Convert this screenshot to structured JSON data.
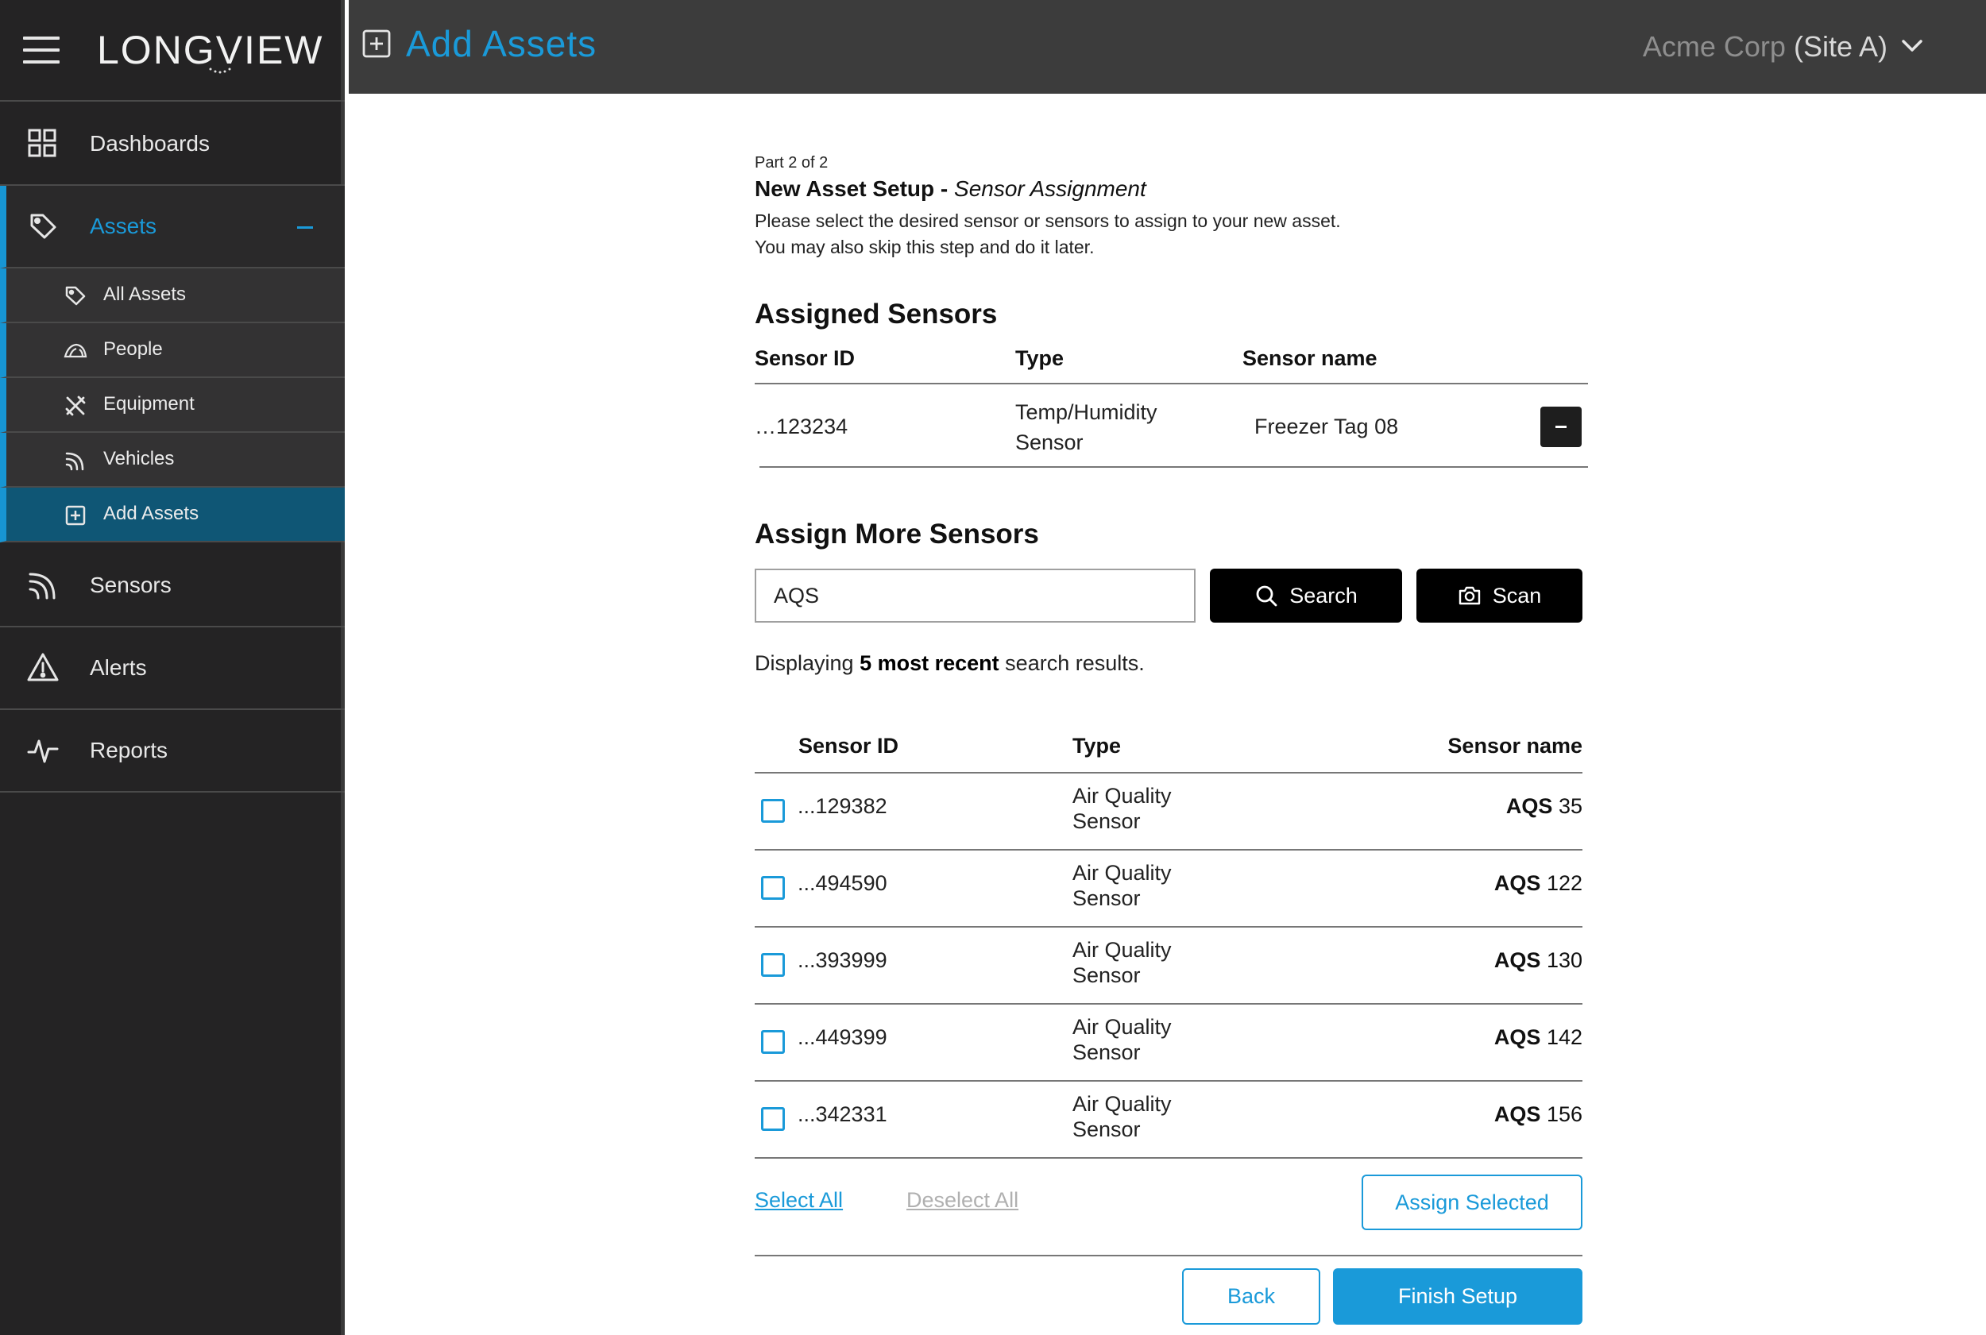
{
  "app": {
    "logo_text": "LONGVIEW",
    "page_title": "Add Assets",
    "org_name": "Acme Corp",
    "org_site": "(Site A)"
  },
  "sidebar": {
    "items": [
      {
        "label": "Dashboards",
        "icon": "dashboard-grid-icon"
      },
      {
        "label": "Assets",
        "icon": "tag-icon"
      },
      {
        "label": "Sensors",
        "icon": "sensor-signal-icon"
      },
      {
        "label": "Alerts",
        "icon": "alert-triangle-icon"
      },
      {
        "label": "Reports",
        "icon": "pulse-icon"
      }
    ],
    "sub_items": [
      {
        "label": "All Assets",
        "icon": "tag-icon"
      },
      {
        "label": "People",
        "icon": "people-icon"
      },
      {
        "label": "Equipment",
        "icon": "tools-icon"
      },
      {
        "label": "Vehicles",
        "icon": "signal-icon"
      },
      {
        "label": "Add Assets",
        "icon": "plus-square-icon"
      }
    ],
    "accent": "#1a9ad9"
  },
  "setup": {
    "part": "Part 2 of 2",
    "title": "New Asset Setup -",
    "subtitle": "Sensor Assignment",
    "desc_line1": "Please select the desired sensor or sensors to assign to your new asset.",
    "desc_line2": "You may also skip this step and do it later."
  },
  "assigned": {
    "heading": "Assigned Sensors",
    "columns": [
      "Sensor ID",
      "Type",
      "Sensor name"
    ],
    "rows": [
      {
        "id": "…123234",
        "type_line1": "Temp/Humidity",
        "type_line2": "Sensor",
        "name": "Freezer Tag 08"
      }
    ]
  },
  "assign_more": {
    "heading": "Assign More Sensors",
    "search_value": "AQS",
    "search_label": "Search",
    "scan_label": "Scan",
    "display_pre": "Displaying",
    "display_bold": "5 most recent",
    "display_post": "search results."
  },
  "results": {
    "columns": [
      "Sensor ID",
      "Type",
      "Sensor name"
    ],
    "rows": [
      {
        "id": "...129382",
        "type_line1": "Air Quality",
        "type_line2": "Sensor",
        "name_bold": "AQS",
        "name_num": "35",
        "checked": false
      },
      {
        "id": "...494590",
        "type_line1": "Air Quality",
        "type_line2": "Sensor",
        "name_bold": "AQS",
        "name_num": "122",
        "checked": false
      },
      {
        "id": "...393999",
        "type_line1": "Air Quality",
        "type_line2": "Sensor",
        "name_bold": "AQS",
        "name_num": "130",
        "checked": false
      },
      {
        "id": "...449399",
        "type_line1": "Air Quality",
        "type_line2": "Sensor",
        "name_bold": "AQS",
        "name_num": "142",
        "checked": false
      },
      {
        "id": "...342331",
        "type_line1": "Air Quality",
        "type_line2": "Sensor",
        "name_bold": "AQS",
        "name_num": "156",
        "checked": false
      }
    ]
  },
  "actions": {
    "select_all": "Select  All",
    "deselect_all": "Deselect All",
    "assign_selected": "Assign Selected",
    "back": "Back",
    "finish": "Finish Setup"
  }
}
